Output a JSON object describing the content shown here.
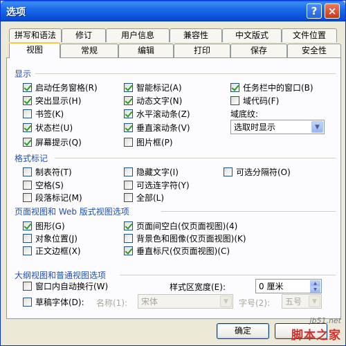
{
  "window": {
    "title": "选项",
    "help_label": "?",
    "close_label": "×"
  },
  "tabs_top": [
    "拼写和语法",
    "修订",
    "用户信息",
    "兼容性",
    "中文版式",
    "文件位置"
  ],
  "tabs_bottom": [
    "视图",
    "常规",
    "编辑",
    "打印",
    "保存",
    "安全性"
  ],
  "active_tab": "视图",
  "sections": {
    "display": {
      "title": "显示",
      "col1": [
        {
          "label": "启动任务窗格(R)",
          "checked": true
        },
        {
          "label": "突出显示(H)",
          "checked": true
        },
        {
          "label": "书签(K)",
          "checked": false
        },
        {
          "label": "状态栏(U)",
          "checked": true
        },
        {
          "label": "屏幕提示(Q)",
          "checked": true
        }
      ],
      "col2": [
        {
          "label": "智能标记(A)",
          "checked": true
        },
        {
          "label": "动态文字(N)",
          "checked": true
        },
        {
          "label": "水平滚动条(Z)",
          "checked": true
        },
        {
          "label": "垂直滚动条(V)",
          "checked": true
        },
        {
          "label": "图片框(P)",
          "checked": false
        }
      ],
      "col3": [
        {
          "label": "任务栏中的窗口(B)",
          "checked": true
        },
        {
          "label": "域代码(F)",
          "checked": false
        }
      ],
      "field_shading_label": "域底纹:",
      "field_shading_value": "选取时显示"
    },
    "format_marks": {
      "title": "格式标记",
      "col1": [
        {
          "label": "制表符(T)",
          "checked": false
        },
        {
          "label": "空格(S)",
          "checked": false
        },
        {
          "label": "段落标记(M)",
          "checked": false
        }
      ],
      "col2": [
        {
          "label": "隐藏文字(I)",
          "checked": false
        },
        {
          "label": "可选连字符(Y)",
          "checked": false
        },
        {
          "label": "全部(L)",
          "checked": false
        }
      ],
      "col3": [
        {
          "label": "可选分隔符(O)",
          "checked": false
        }
      ]
    },
    "page_view": {
      "title": "页面视图和 Web 版式视图选项",
      "col1": [
        {
          "label": "图形(G)",
          "checked": true
        },
        {
          "label": "对象位置(J)",
          "checked": false
        },
        {
          "label": "正文边框(X)",
          "checked": false
        }
      ],
      "col2": [
        {
          "label": "页面间空白(仅页面视图)(4)",
          "checked": true
        },
        {
          "label": "背景色和图像(仅页面视图)(K)",
          "checked": false
        },
        {
          "label": "垂直标尺(仅页面视图)(C)",
          "checked": true
        }
      ]
    },
    "outline": {
      "title": "大纲视图和普通视图选项",
      "wrap_label": "窗口内自动换行(W)",
      "draft_font_label": "草稿字体(D):",
      "style_width_label": "样式区宽度(E):",
      "style_width_value": "0 厘米",
      "name_label": "名称(1):",
      "name_value": "宋体",
      "size_label": "字号(2):",
      "size_value": "五号"
    }
  },
  "buttons": {
    "ok": "确定"
  },
  "watermark": {
    "site": "jb51.net",
    "name": "脚本之家"
  },
  "colors": {
    "titlebar": "#0A4FD6",
    "section_title": "#1F4FB5",
    "check": "#21A121",
    "active_tab_accent": "#FFC83C"
  }
}
